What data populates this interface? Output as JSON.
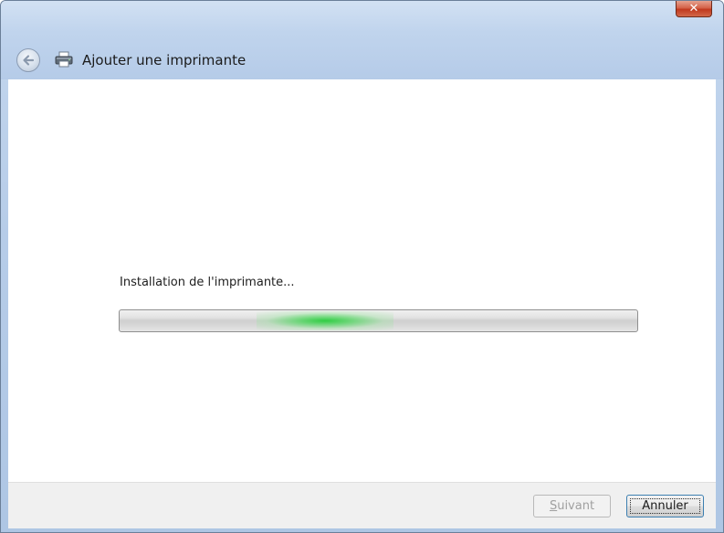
{
  "window": {
    "title": "Ajouter une imprimante",
    "close_glyph": "✕"
  },
  "icons": {
    "back": "back-arrow-icon",
    "printer": "printer-icon",
    "close": "close-icon"
  },
  "main": {
    "status_text": "Installation de l'imprimante...",
    "progress_style": "indeterminate-marquee"
  },
  "footer": {
    "next_button": {
      "label_first": "S",
      "label_rest": "uivant",
      "enabled": false
    },
    "cancel_button": {
      "label": "Annuler",
      "focused": true
    }
  },
  "colors": {
    "progress_glow": "#28cd3c",
    "close_button": "#c0391e",
    "focus_border": "#3c7fb1"
  }
}
